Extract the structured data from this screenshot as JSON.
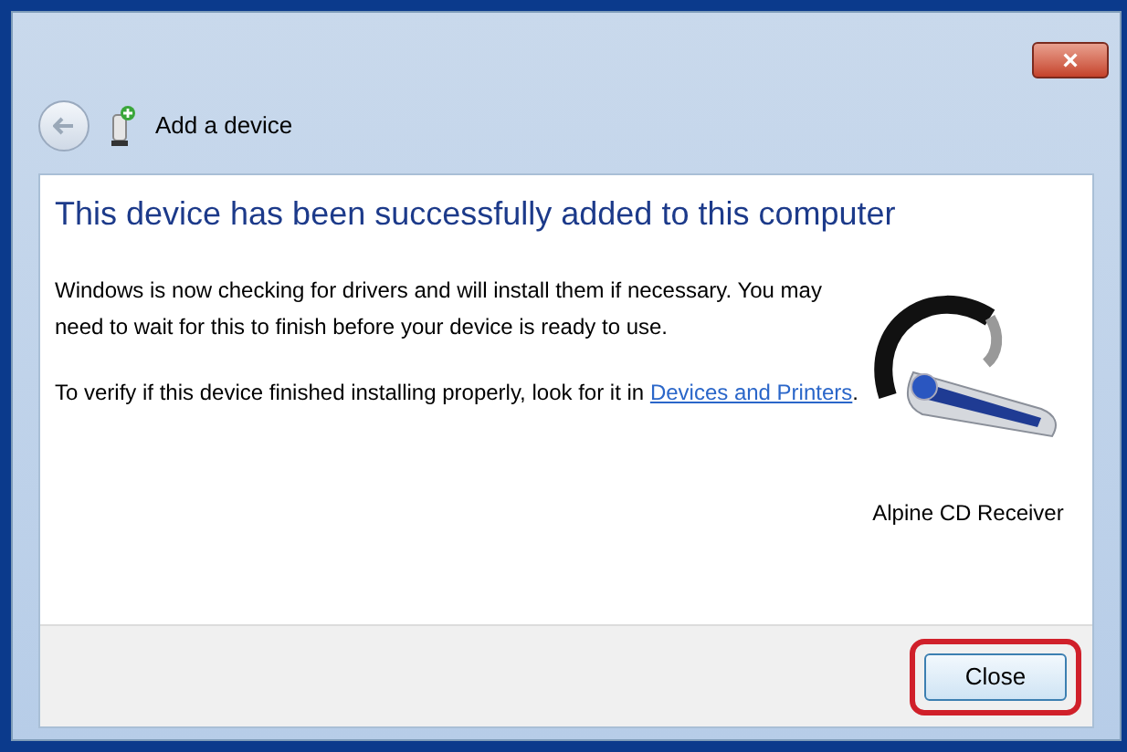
{
  "window": {
    "close_button": "×"
  },
  "nav": {
    "title": "Add a device"
  },
  "heading": "This device has been successfully added to this computer",
  "paragraphs": [
    {
      "text": "Windows is now checking for drivers and will install them if necessary. You may need to wait for this to finish before your device is ready to use."
    },
    {
      "text": "To verify if this device finished installing properly, look for it in",
      "link": "Devices and Printers",
      "after": "."
    }
  ],
  "device": {
    "name": "Alpine CD Receiver"
  },
  "buttons": [
    {
      "label": "Close",
      "highlighted": true
    }
  ]
}
